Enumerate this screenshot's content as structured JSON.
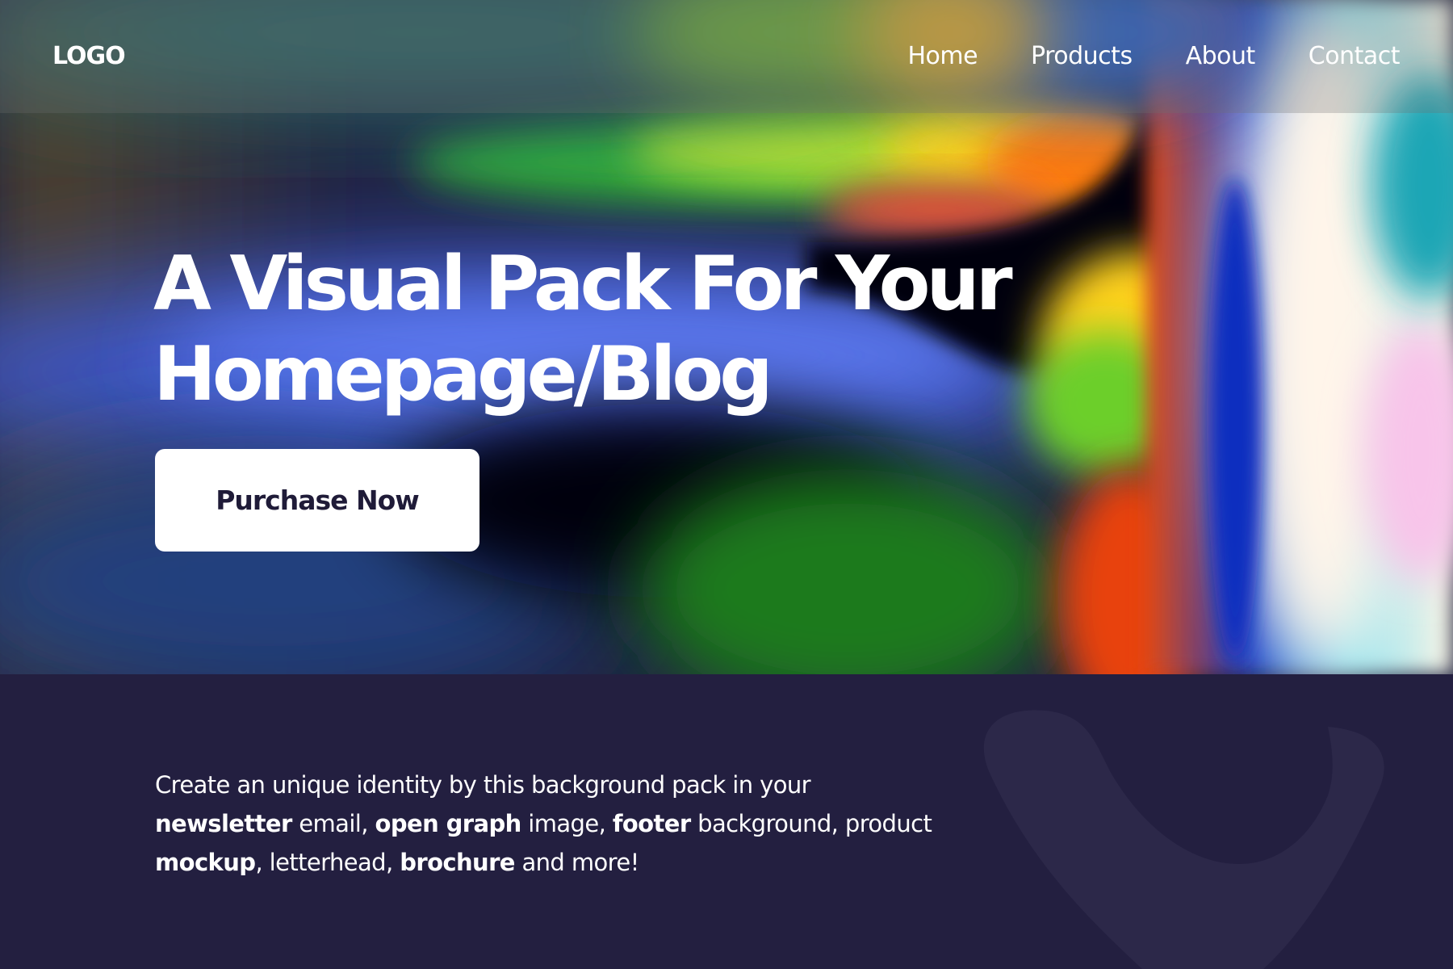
{
  "header": {
    "logo": "LOGO",
    "nav": [
      {
        "label": "Home"
      },
      {
        "label": "Products"
      },
      {
        "label": "About"
      },
      {
        "label": "Contact"
      }
    ]
  },
  "hero": {
    "title_line_1": "A Visual Pack For Your",
    "title_line_2": "Homepage/Blog",
    "cta_label": "Purchase Now"
  },
  "description": {
    "line_1": "Create an unique identity by this background pack in your",
    "newsletter": "newsletter",
    "email": " email, ",
    "open_graph": "open graph",
    "image": " image, ",
    "footer": "footer",
    "background_product": " background, product",
    "mockup": "mockup",
    "letterhead": ", letterhead, ",
    "brochure": "brochure",
    "and_more": " and more!"
  },
  "colors": {
    "lower_background": "#231f40",
    "button_background": "#ffffff",
    "button_text": "#1f1b38",
    "text": "#ffffff"
  }
}
